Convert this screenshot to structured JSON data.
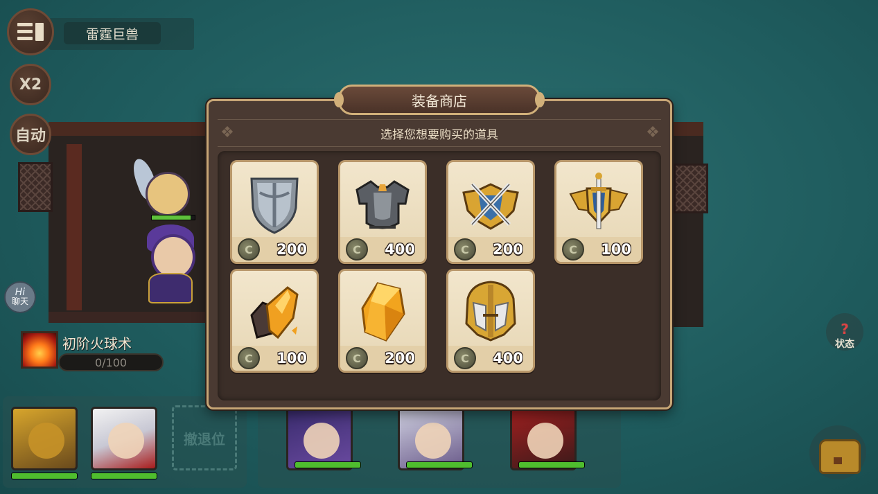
{
  "hud": {
    "boss_name": "雷霆巨兽",
    "speed_label": "X2",
    "auto_label": "自动",
    "chat_hi": "Hi",
    "chat_label": "聊天",
    "status_label": "状态"
  },
  "skill": {
    "name": "初阶火球术",
    "progress_text": "0/100",
    "progress": 0
  },
  "party": {
    "retreat_slot_label": "撤退位",
    "front_row_hp": [
      1.0,
      1.0
    ],
    "back_row_hp": [
      1.0,
      1.0,
      1.0
    ]
  },
  "shop": {
    "title": "装备商店",
    "subtitle": "选择您想要购买的道具",
    "currency_icon": "coin-icon",
    "items": [
      {
        "icon": "silver-shield-icon",
        "price": "200"
      },
      {
        "icon": "chest-armor-icon",
        "price": "400"
      },
      {
        "icon": "crossed-swords-emblem-icon",
        "price": "200"
      },
      {
        "icon": "winged-sword-emblem-icon",
        "price": "100"
      },
      {
        "icon": "amber-ore-icon",
        "price": "100"
      },
      {
        "icon": "amber-crystal-icon",
        "price": "200"
      },
      {
        "icon": "golden-helmet-icon",
        "price": "400"
      }
    ]
  },
  "colors": {
    "background": "#1f5c5e",
    "panel": "#4a3a32",
    "card": "#f2e6cc",
    "hp_green": "#4fbd2e"
  }
}
